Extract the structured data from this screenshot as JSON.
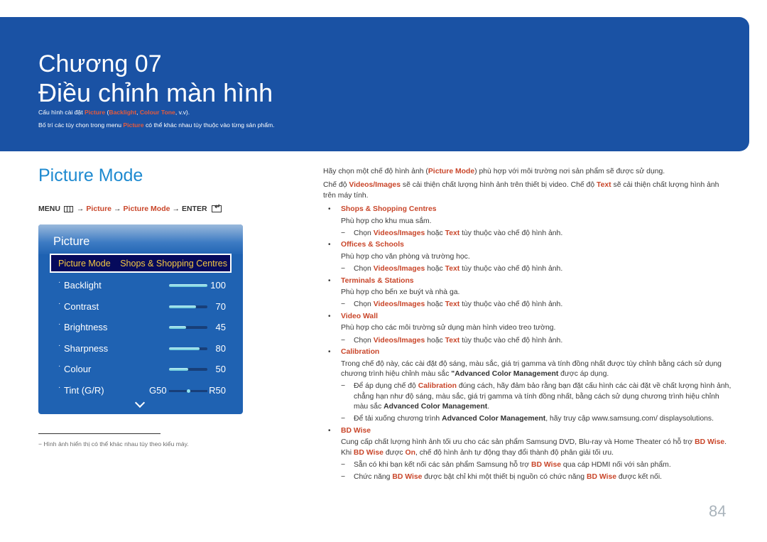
{
  "banner": {
    "chapter": "Chương 07",
    "title": "Điều chỉnh màn hình",
    "line1": {
      "pre": "Cấu hình cài đặt ",
      "picture": "Picture",
      "open": " (",
      "backlight": "Backlight",
      "comma": ", ",
      "colour_tone": "Colour Tone",
      "post": ", v.v)."
    },
    "line2": {
      "pre": "Bố trí các tùy chọn trong menu ",
      "picture": "Picture",
      "post": " có thể khác nhau tùy thuộc vào từng sản phẩm."
    }
  },
  "section": {
    "title": "Picture Mode"
  },
  "menu_path": {
    "menu": "MENU",
    "arrow": "→",
    "picture": "Picture",
    "picture_mode": "Picture Mode",
    "enter": "ENTER"
  },
  "osd": {
    "title": "Picture",
    "selected": {
      "label": "Picture Mode",
      "value": "Shops & Shopping Centres"
    },
    "rows": [
      {
        "label": "Backlight",
        "value": "100",
        "percent": 100
      },
      {
        "label": "Contrast",
        "value": "70",
        "percent": 70
      },
      {
        "label": "Brightness",
        "value": "45",
        "percent": 45
      },
      {
        "label": "Sharpness",
        "value": "80",
        "percent": 80
      },
      {
        "label": "Colour",
        "value": "50",
        "percent": 50
      }
    ],
    "tint": {
      "label": "Tint (G/R)",
      "left": "G50",
      "right": "R50",
      "position_percent": 50
    },
    "bullet": "·"
  },
  "footnote": "−  Hình ảnh hiển thị có thể khác nhau tùy theo kiểu máy.",
  "content": {
    "intro1": {
      "pre": "Hãy chọn một chế độ hình ảnh (",
      "hl": "Picture Mode",
      "post": ") phù hợp với môi trường nơi sản phẩm sẽ được sử dụng."
    },
    "intro2": {
      "pre": "Chế độ ",
      "hl1": "Videos/Images",
      "mid": " sẽ cải thiện chất lượng hình ảnh trên thiết bị video. Chế độ ",
      "hl2": "Text",
      "post": " sẽ cải thiện chất lượng hình ảnh trên máy tính."
    },
    "bullet": "•",
    "dash": "−",
    "choose_note": {
      "pre": "Chọn ",
      "hl1": "Videos/Images",
      "mid": " hoặc ",
      "hl2": "Text",
      "post": " tùy thuộc vào chế độ hình ảnh."
    },
    "items": [
      {
        "title": "Shops & Shopping Centres",
        "desc": "Phù hợp cho khu mua sắm."
      },
      {
        "title": "Offices & Schools",
        "desc": "Phù hợp cho văn phòng và trường học."
      },
      {
        "title": "Terminals & Stations",
        "desc": "Phù hợp cho bến xe buýt và nhà ga."
      },
      {
        "title": "Video Wall",
        "desc": "Phù hợp cho các môi trường sử dụng màn hình video treo tường."
      }
    ],
    "calibration": {
      "title": "Calibration",
      "desc_pre": "Trong chế độ này, các cài đặt độ sáng, màu sắc, giá trị gamma và tính đồng nhất được tùy chỉnh bằng cách sử dụng chương trình hiệu chỉnh màu sắc ",
      "desc_bold": "\"Advanced Color Management",
      "desc_post": " được áp dụng.",
      "note1_pre": "Để áp dụng chế độ ",
      "note1_hl": "Calibration",
      "note1_mid": " đúng cách, hãy đảm bảo rằng bạn đặt cấu hình các cài đặt về chất lượng hình ảnh, chẳng hạn như độ sáng, màu sắc, giá trị gamma và tính đồng nhất, bằng cách sử dụng chương trình hiệu chỉnh màu sắc ",
      "note1_bold": "Advanced Color Management",
      "note1_post": ".",
      "note2_pre": "Để tải xuống chương trình ",
      "note2_bold": "Advanced Color Management",
      "note2_post": ", hãy truy cập www.samsung.com/ displaysolutions."
    },
    "bdwise": {
      "title": "BD Wise",
      "desc_pre": "Cung cấp chất lượng hình ảnh tối ưu cho các sản phẩm Samsung DVD, Blu-ray và Home Theater có hỗ trợ ",
      "hl": "BD Wise",
      "desc_mid1": ". Khi ",
      "desc_mid2": " được ",
      "on": "On",
      "desc_post": ", chế độ hình ảnh tự động thay đổi thành độ phân giải tối ưu.",
      "note1_pre": "Sẵn có khi bạn kết nối các sản phẩm Samsung hỗ trợ ",
      "note1_post": " qua cáp HDMI nối với sản phẩm.",
      "note2_pre": "Chức năng ",
      "note2_mid": " được bật chỉ khi một thiết bị nguồn có chức năng ",
      "note2_post": " được kết nối."
    }
  },
  "page_number": "84"
}
